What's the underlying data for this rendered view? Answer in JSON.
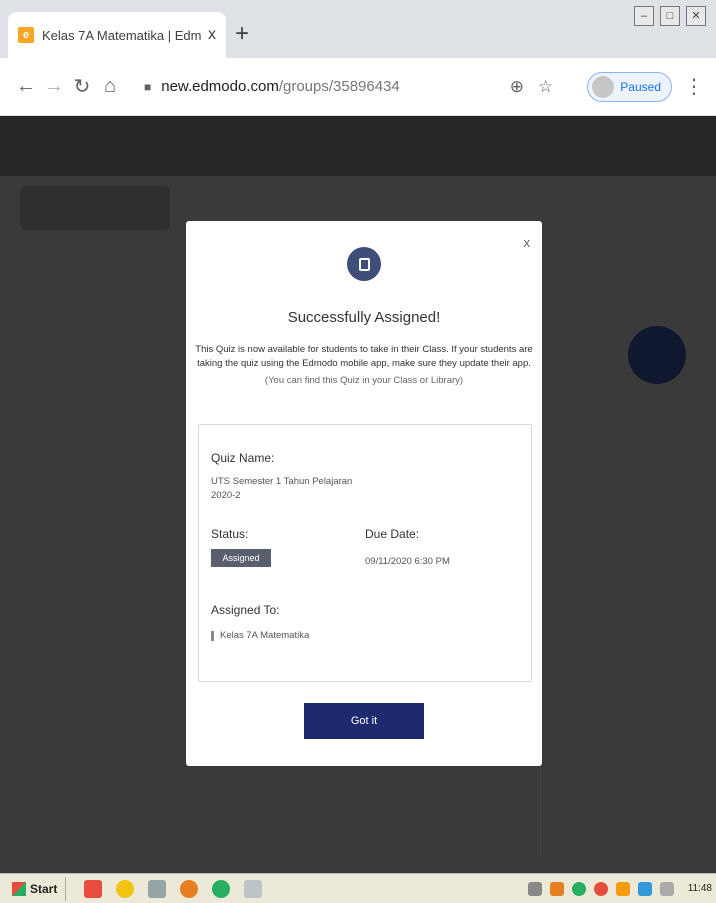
{
  "browser": {
    "tab_title": "Kelas 7A Matematika | Edmodo",
    "tab_close": "x",
    "new_tab": "+",
    "url_host": "new.edmodo.com",
    "url_path": "/groups/35896434",
    "profile_status": "Paused"
  },
  "modal": {
    "close": "x",
    "title": "Successfully Assigned!",
    "message": "This Quiz is now available for students to take in their Class. If your students are taking the quiz using the Edmodo mobile app, make sure they update their app.",
    "message_hint": "(You can find this Quiz in your Class or Library)",
    "quiz_name_label": "Quiz Name:",
    "quiz_name": "UTS Semester 1 Tahun Pelajaran 2020-2",
    "status_label": "Status:",
    "status_value": "Assigned",
    "due_label": "Due Date:",
    "due_value": "09/11/2020 6:30 PM",
    "assigned_to_label": "Assigned To:",
    "assigned_class": "Kelas 7A Matematika",
    "button": "Got it"
  },
  "taskbar": {
    "start": "Start",
    "clock": "11:48"
  },
  "colors": {
    "primary_button": "#1e2a6e",
    "badge": "#5a5f6e",
    "overlay": "#3a3a3a"
  }
}
